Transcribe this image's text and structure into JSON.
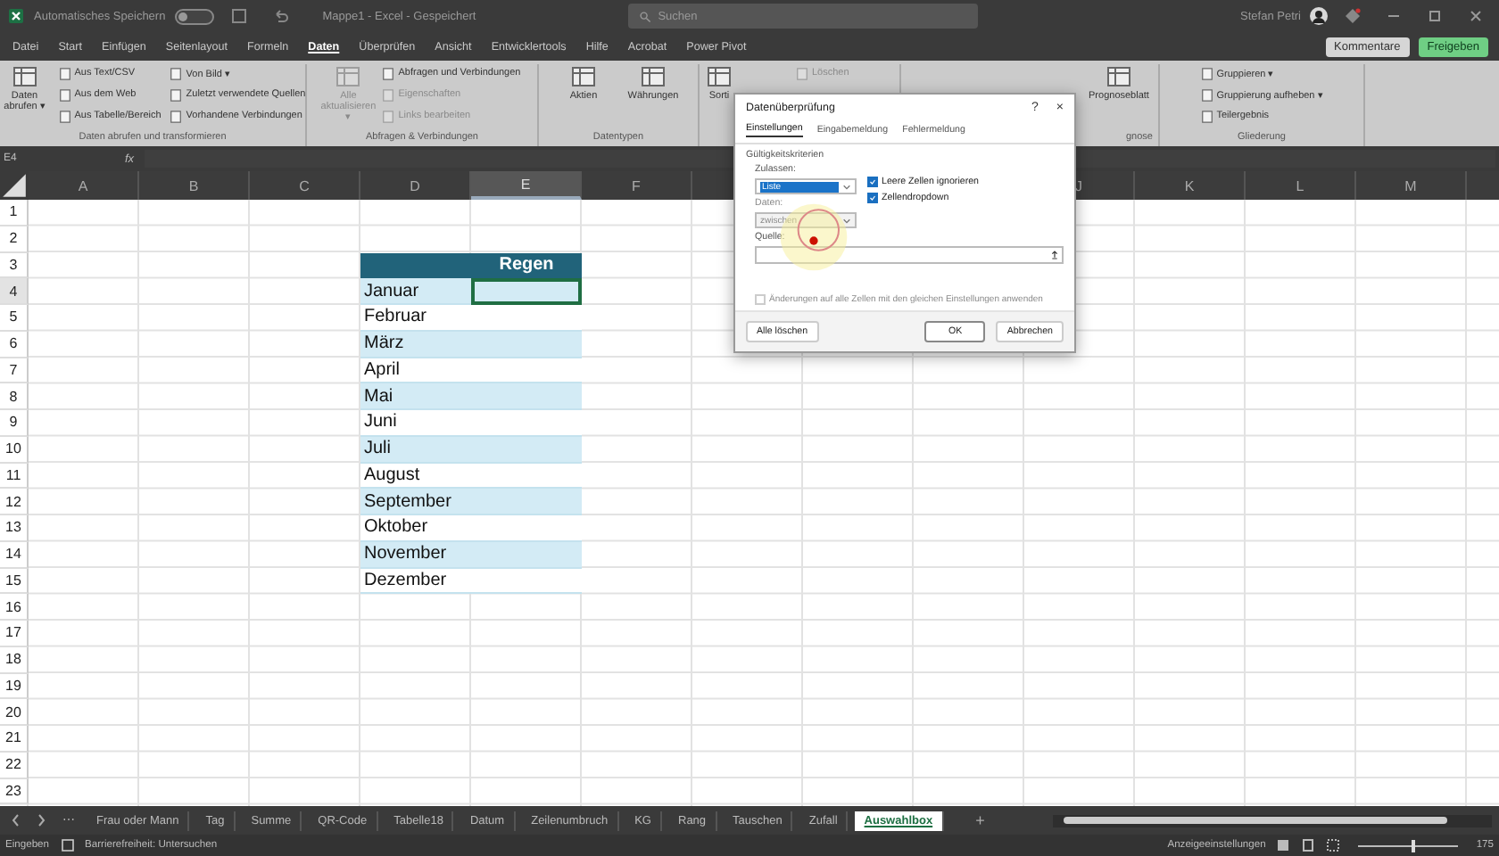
{
  "title_bar": {
    "autosave_label": "Automatisches Speichern",
    "autosave_on": false,
    "document_title": "Mappe1 - Excel - Gespeichert",
    "search_placeholder": "Suchen",
    "user_name": "Stefan Petri"
  },
  "menu_tabs": [
    {
      "label": "Datei",
      "selected": false
    },
    {
      "label": "Start",
      "selected": false
    },
    {
      "label": "Einfügen",
      "selected": false
    },
    {
      "label": "Seitenlayout",
      "selected": false
    },
    {
      "label": "Formeln",
      "selected": false
    },
    {
      "label": "Daten",
      "selected": true
    },
    {
      "label": "Überprüfen",
      "selected": false
    },
    {
      "label": "Ansicht",
      "selected": false
    },
    {
      "label": "Entwicklertools",
      "selected": false
    },
    {
      "label": "Hilfe",
      "selected": false
    },
    {
      "label": "Acrobat",
      "selected": false
    },
    {
      "label": "Power Pivot",
      "selected": false
    }
  ],
  "share_buttons": {
    "comments": "Kommentare",
    "share": "Freigeben"
  },
  "ribbon_groups": [
    {
      "label": "Daten abrufen und transformieren",
      "items": [
        {
          "kind": "large",
          "label": "Daten abrufen ▾",
          "disabled": false
        },
        {
          "kind": "small",
          "label": "Aus Text/CSV",
          "disabled": false
        },
        {
          "kind": "small",
          "label": "Aus dem Web",
          "disabled": false
        },
        {
          "kind": "small",
          "label": "Aus Tabelle/Bereich",
          "disabled": false
        },
        {
          "kind": "small",
          "label": "Von Bild ▾",
          "disabled": false
        },
        {
          "kind": "small",
          "label": "Zuletzt verwendete Quellen",
          "disabled": false
        },
        {
          "kind": "small",
          "label": "Vorhandene Verbindungen",
          "disabled": false
        }
      ]
    },
    {
      "label": "Abfragen & Verbindungen",
      "items": [
        {
          "kind": "large",
          "label": "Alle aktualisieren ▾",
          "disabled": true
        },
        {
          "kind": "small",
          "label": "Abfragen und Verbindungen",
          "disabled": false
        },
        {
          "kind": "small",
          "label": "Eigenschaften",
          "disabled": true
        },
        {
          "kind": "small",
          "label": "Links bearbeiten",
          "disabled": true
        }
      ]
    },
    {
      "label": "Datentypen",
      "items": [
        {
          "kind": "large",
          "label": "Aktien",
          "disabled": false
        },
        {
          "kind": "large",
          "label": "Währungen",
          "disabled": false
        }
      ]
    },
    {
      "items": [
        {
          "kind": "large",
          "label": "Sorti",
          "disabled": false
        },
        {
          "kind": "small",
          "label": "Löschen",
          "disabled": true
        }
      ]
    },
    {
      "label": "gnose",
      "items": [
        {
          "kind": "large",
          "label": "Prognoseblatt",
          "disabled": false
        }
      ]
    },
    {
      "label": "Gliederung",
      "items": [
        {
          "kind": "small",
          "label": "Gruppieren ▾",
          "disabled": false
        },
        {
          "kind": "small",
          "label": "Gruppierung aufheben ▾",
          "disabled": false
        },
        {
          "kind": "small",
          "label": "Teilergebnis",
          "disabled": false
        }
      ]
    }
  ],
  "formula_bar": {
    "name_box": "E4",
    "function_button": "fx"
  },
  "columns": [
    {
      "label": "A",
      "selected": false
    },
    {
      "label": "B",
      "selected": false
    },
    {
      "label": "C",
      "selected": false
    },
    {
      "label": "D",
      "selected": false
    },
    {
      "label": "E",
      "selected": true
    },
    {
      "label": "F",
      "selected": false
    },
    null,
    null,
    null,
    {
      "label": "J",
      "selected": false
    },
    {
      "label": "K",
      "selected": false
    },
    {
      "label": "L",
      "selected": false
    },
    {
      "label": "M",
      "selected": false
    }
  ],
  "rows": [
    {
      "label": "1",
      "selected": false
    },
    {
      "label": "2",
      "selected": false
    },
    {
      "label": "3",
      "selected": false,
      "cells": [
        null,
        null,
        null,
        {
          "kind": "header",
          "selected": false
        },
        {
          "kind": "header",
          "text": "Regen",
          "selected": false
        }
      ]
    },
    {
      "label": "4",
      "selected": true,
      "cells": [
        null,
        null,
        null,
        {
          "kind": "data",
          "text": "Januar",
          "banded": true,
          "selected": false
        },
        {
          "kind": "data",
          "banded": true,
          "selected": true
        }
      ]
    },
    {
      "label": "5",
      "selected": false,
      "cells": [
        null,
        null,
        null,
        {
          "kind": "data",
          "text": "Februar",
          "banded": false,
          "selected": false
        },
        {
          "kind": "data",
          "banded": false,
          "selected": false
        }
      ]
    },
    {
      "label": "6",
      "selected": false,
      "cells": [
        null,
        null,
        null,
        {
          "kind": "data",
          "text": "März",
          "banded": true,
          "selected": false
        },
        {
          "kind": "data",
          "banded": true,
          "selected": false
        }
      ]
    },
    {
      "label": "7",
      "selected": false,
      "cells": [
        null,
        null,
        null,
        {
          "kind": "data",
          "text": "April",
          "banded": false,
          "selected": false
        },
        {
          "kind": "data",
          "banded": false,
          "selected": false
        }
      ]
    },
    {
      "label": "8",
      "selected": false,
      "cells": [
        null,
        null,
        null,
        {
          "kind": "data",
          "text": "Mai",
          "banded": true,
          "selected": false
        },
        {
          "kind": "data",
          "banded": true,
          "selected": false
        }
      ]
    },
    {
      "label": "9",
      "selected": false,
      "cells": [
        null,
        null,
        null,
        {
          "kind": "data",
          "text": "Juni",
          "banded": false,
          "selected": false
        },
        {
          "kind": "data",
          "banded": false,
          "selected": false
        }
      ]
    },
    {
      "label": "10",
      "selected": false,
      "cells": [
        null,
        null,
        null,
        {
          "kind": "data",
          "text": "Juli",
          "banded": true,
          "selected": false
        },
        {
          "kind": "data",
          "banded": true,
          "selected": false
        }
      ]
    },
    {
      "label": "11",
      "selected": false,
      "cells": [
        null,
        null,
        null,
        {
          "kind": "data",
          "text": "August",
          "banded": false,
          "selected": false
        },
        {
          "kind": "data",
          "banded": false,
          "selected": false
        }
      ]
    },
    {
      "label": "12",
      "selected": false,
      "cells": [
        null,
        null,
        null,
        {
          "kind": "data",
          "text": "September",
          "banded": true,
          "selected": false
        },
        {
          "kind": "data",
          "banded": true,
          "selected": false
        }
      ]
    },
    {
      "label": "13",
      "selected": false,
      "cells": [
        null,
        null,
        null,
        {
          "kind": "data",
          "text": "Oktober",
          "banded": false,
          "selected": false
        },
        {
          "kind": "data",
          "banded": false,
          "selected": false
        }
      ]
    },
    {
      "label": "14",
      "selected": false,
      "cells": [
        null,
        null,
        null,
        {
          "kind": "data",
          "text": "November",
          "banded": true,
          "selected": false
        },
        {
          "kind": "data",
          "banded": true,
          "selected": false
        }
      ]
    },
    {
      "label": "15",
      "selected": false,
      "cells": [
        null,
        null,
        null,
        {
          "kind": "data",
          "text": "Dezember",
          "banded": false,
          "selected": false
        },
        {
          "kind": "data",
          "banded": false,
          "selected": false
        }
      ]
    },
    {
      "label": "16",
      "selected": false
    },
    {
      "label": "17",
      "selected": false
    },
    {
      "label": "18",
      "selected": false
    },
    {
      "label": "19",
      "selected": false
    },
    {
      "label": "20",
      "selected": false
    },
    {
      "label": "21",
      "selected": false
    },
    {
      "label": "22",
      "selected": false
    },
    {
      "label": "23",
      "selected": false
    }
  ],
  "dialog": {
    "title": "Datenüberprüfung",
    "help": "?",
    "close": "×",
    "tabs": [
      {
        "label": "Einstellungen",
        "selected": true
      },
      {
        "label": "Eingabemeldung",
        "selected": false
      },
      {
        "label": "Fehlermeldung",
        "selected": false
      }
    ],
    "section_label": "Gültigkeitskriterien",
    "allow_label": "Zulassen:",
    "allow_value": "Liste",
    "options": [
      {
        "label": "Leere Zellen ignorieren",
        "checked": true
      },
      {
        "label": "Zellendropdown",
        "checked": true
      }
    ],
    "data_label": "Daten:",
    "data_value": "zwischen",
    "data_disabled": true,
    "source_label": "Quelle:",
    "apply_all": {
      "label": "Änderungen auf alle Zellen mit den gleichen Einstellungen anwenden",
      "checked": false,
      "disabled": true
    },
    "buttons": [
      {
        "label": "Alle löschen",
        "kind": "secondary"
      },
      {
        "label": "OK",
        "kind": "primary"
      },
      {
        "label": "Abbrechen",
        "kind": "secondary"
      }
    ]
  },
  "sheet_tabs": {
    "more": "⋯",
    "add": "+",
    "tabs": [
      {
        "label": "Frau oder Mann",
        "selected": false
      },
      {
        "label": "Tag",
        "selected": false
      },
      {
        "label": "Summe",
        "selected": false
      },
      {
        "label": "QR-Code",
        "selected": false
      },
      {
        "label": "Tabelle18",
        "selected": false
      },
      {
        "label": "Datum",
        "selected": false
      },
      {
        "label": "Zeilenumbruch",
        "selected": false
      },
      {
        "label": "KG",
        "selected": false
      },
      {
        "label": "Rang",
        "selected": false
      },
      {
        "label": "Tauschen",
        "selected": false
      },
      {
        "label": "Zufall",
        "selected": false
      },
      {
        "label": "Auswahlbox",
        "selected": true
      }
    ]
  },
  "status_bar": {
    "mode": "Eingeben",
    "accessibility": "Barrierefreiheit: Untersuchen",
    "display_settings": "Anzeigeeinstellungen",
    "zoom": {
      "level": 0.55,
      "reading": "175"
    }
  }
}
